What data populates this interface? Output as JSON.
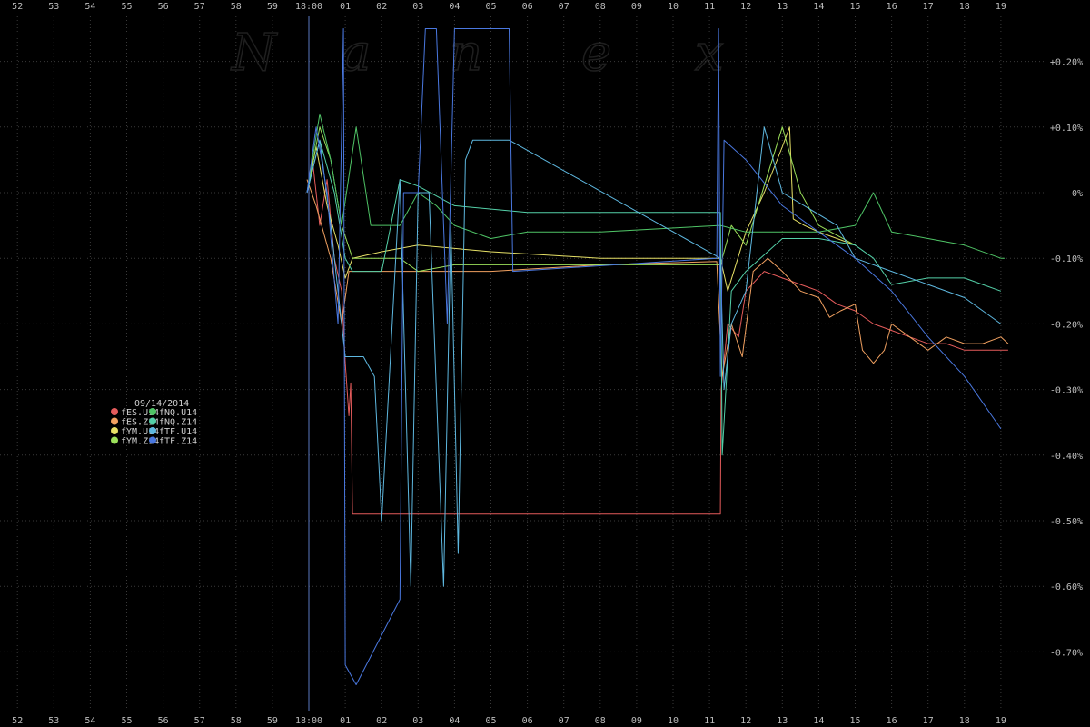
{
  "chart_data": {
    "type": "line",
    "title": "",
    "xlabel": "",
    "ylabel": "",
    "watermark": [
      "N",
      "a",
      "n",
      "e",
      "x"
    ],
    "date": "09/14/2014",
    "x_ticks_top": [
      "52",
      "53",
      "54",
      "55",
      "56",
      "57",
      "58",
      "59",
      "18:00",
      "01",
      "02",
      "03",
      "04",
      "05",
      "06",
      "07",
      "08",
      "09",
      "10",
      "11",
      "12",
      "13",
      "14",
      "15",
      "16",
      "17",
      "18",
      "19"
    ],
    "x_ticks_bottom": [
      "52",
      "53",
      "54",
      "55",
      "56",
      "57",
      "58",
      "59",
      "18:00",
      "01",
      "02",
      "03",
      "04",
      "05",
      "06",
      "07",
      "08",
      "09",
      "10",
      "11",
      "12",
      "13",
      "14",
      "15",
      "16",
      "17",
      "18",
      "19"
    ],
    "y_tick_labels": [
      "+0.20%",
      "+0.10%",
      "0%",
      "-0.10%",
      "-0.20%",
      "-0.30%",
      "-0.40%",
      "-0.50%",
      "-0.60%",
      "-0.70%"
    ],
    "y_ticks": [
      0.2,
      0.1,
      0,
      -0.1,
      -0.2,
      -0.3,
      -0.4,
      -0.5,
      -0.6,
      -0.7
    ],
    "ylim": [
      -0.82,
      0.26
    ],
    "xlim": [
      -8.4,
      19.4
    ],
    "grid": true,
    "legend_position": "left-middle",
    "colors": {
      "background": "#000000",
      "grid": "#3a3a3a",
      "tick_text": "#bdbdbd",
      "watermark": "#1f1f1f",
      "start_line": "#5a78c0"
    },
    "series": [
      {
        "name": "fES.U14",
        "color": "#e45b5b",
        "points": [
          [
            -0.05,
            0.0
          ],
          [
            0.1,
            0.05
          ],
          [
            0.3,
            -0.05
          ],
          [
            0.5,
            0.02
          ],
          [
            0.7,
            -0.1
          ],
          [
            0.9,
            -0.15
          ],
          [
            1.0,
            -0.26
          ],
          [
            1.05,
            -0.3
          ],
          [
            1.1,
            -0.34
          ],
          [
            1.15,
            -0.29
          ],
          [
            1.2,
            -0.49
          ],
          [
            11.3,
            -0.49
          ],
          [
            11.32,
            -0.3
          ],
          [
            11.5,
            -0.2
          ],
          [
            11.8,
            -0.22
          ],
          [
            12.0,
            -0.15
          ],
          [
            12.5,
            -0.12
          ],
          [
            13.0,
            -0.13
          ],
          [
            13.5,
            -0.14
          ],
          [
            14.0,
            -0.15
          ],
          [
            14.5,
            -0.17
          ],
          [
            15.0,
            -0.18
          ],
          [
            15.5,
            -0.2
          ],
          [
            16.0,
            -0.21
          ],
          [
            16.5,
            -0.22
          ],
          [
            17.0,
            -0.23
          ],
          [
            17.5,
            -0.23
          ],
          [
            18.0,
            -0.24
          ],
          [
            18.5,
            -0.24
          ],
          [
            19.0,
            -0.24
          ],
          [
            19.2,
            -0.24
          ]
        ]
      },
      {
        "name": "fES.Z14",
        "color": "#f0a060",
        "points": [
          [
            -0.05,
            0.02
          ],
          [
            0.2,
            -0.02
          ],
          [
            0.6,
            -0.1
          ],
          [
            0.9,
            -0.2
          ],
          [
            1.1,
            -0.12
          ],
          [
            1.5,
            -0.12
          ],
          [
            2.0,
            -0.12
          ],
          [
            3.0,
            -0.12
          ],
          [
            5.0,
            -0.12
          ],
          [
            8.0,
            -0.11
          ],
          [
            11.2,
            -0.105
          ],
          [
            11.35,
            -0.28
          ],
          [
            11.6,
            -0.2
          ],
          [
            11.9,
            -0.25
          ],
          [
            12.2,
            -0.12
          ],
          [
            12.6,
            -0.1
          ],
          [
            13.0,
            -0.12
          ],
          [
            13.5,
            -0.15
          ],
          [
            14.0,
            -0.16
          ],
          [
            14.3,
            -0.19
          ],
          [
            14.6,
            -0.18
          ],
          [
            15.0,
            -0.17
          ],
          [
            15.2,
            -0.24
          ],
          [
            15.5,
            -0.26
          ],
          [
            15.8,
            -0.24
          ],
          [
            16.0,
            -0.2
          ],
          [
            16.5,
            -0.22
          ],
          [
            17.0,
            -0.24
          ],
          [
            17.5,
            -0.22
          ],
          [
            18.0,
            -0.23
          ],
          [
            18.5,
            -0.23
          ],
          [
            19.0,
            -0.22
          ],
          [
            19.2,
            -0.23
          ]
        ]
      },
      {
        "name": "fYM.U14",
        "color": "#e6e066",
        "points": [
          [
            -0.05,
            0.0
          ],
          [
            0.2,
            0.07
          ],
          [
            0.5,
            -0.02
          ],
          [
            0.8,
            -0.08
          ],
          [
            1.0,
            -0.13
          ],
          [
            1.2,
            -0.1
          ],
          [
            2.0,
            -0.09
          ],
          [
            3.0,
            -0.08
          ],
          [
            5.0,
            -0.09
          ],
          [
            8.0,
            -0.1
          ],
          [
            11.3,
            -0.1
          ],
          [
            11.5,
            -0.15
          ],
          [
            12.0,
            -0.06
          ],
          [
            12.5,
            0.0
          ],
          [
            13.0,
            0.07
          ],
          [
            13.2,
            0.1
          ],
          [
            13.3,
            -0.04
          ],
          [
            13.6,
            -0.05
          ],
          [
            14.0,
            -0.06
          ],
          [
            14.5,
            -0.07
          ],
          [
            15.0,
            -0.08
          ]
        ]
      },
      {
        "name": "fYM.Z14",
        "color": "#9be05a",
        "points": [
          [
            -0.05,
            0.0
          ],
          [
            0.3,
            0.1
          ],
          [
            0.6,
            0.05
          ],
          [
            0.9,
            -0.05
          ],
          [
            1.2,
            -0.1
          ],
          [
            1.5,
            -0.1
          ],
          [
            2.5,
            -0.1
          ],
          [
            3.0,
            -0.12
          ],
          [
            4.0,
            -0.11
          ],
          [
            11.3,
            -0.11
          ],
          [
            11.6,
            -0.05
          ],
          [
            12.0,
            -0.08
          ],
          [
            13.0,
            0.1
          ],
          [
            13.5,
            0.0
          ],
          [
            14.0,
            -0.05
          ],
          [
            15.0,
            -0.08
          ]
        ]
      },
      {
        "name": "fNQ.U14",
        "color": "#4fc466",
        "points": [
          [
            -0.05,
            0.0
          ],
          [
            0.3,
            0.12
          ],
          [
            0.6,
            0.05
          ],
          [
            0.9,
            -0.05
          ],
          [
            1.3,
            0.1
          ],
          [
            1.7,
            -0.05
          ],
          [
            2.5,
            -0.05
          ],
          [
            3.0,
            0.0
          ],
          [
            3.5,
            -0.02
          ],
          [
            4.0,
            -0.05
          ],
          [
            5.0,
            -0.07
          ],
          [
            6.0,
            -0.06
          ],
          [
            8.0,
            -0.06
          ],
          [
            11.3,
            -0.05
          ],
          [
            12.0,
            -0.06
          ],
          [
            14.0,
            -0.06
          ],
          [
            15.0,
            -0.05
          ],
          [
            15.5,
            0.0
          ],
          [
            16.0,
            -0.06
          ],
          [
            17.0,
            -0.07
          ],
          [
            18.0,
            -0.08
          ],
          [
            19.0,
            -0.1
          ],
          [
            19.1,
            -0.1
          ]
        ]
      },
      {
        "name": "fNQ.Z14",
        "color": "#54d0a8",
        "points": [
          [
            -0.05,
            0.0
          ],
          [
            0.3,
            0.08
          ],
          [
            0.7,
            0.0
          ],
          [
            1.0,
            -0.1
          ],
          [
            1.2,
            -0.12
          ],
          [
            2.0,
            -0.12
          ],
          [
            2.5,
            0.02
          ],
          [
            3.0,
            0.01
          ],
          [
            4.0,
            -0.02
          ],
          [
            6.0,
            -0.03
          ],
          [
            9.0,
            -0.03
          ],
          [
            11.3,
            -0.03
          ],
          [
            11.35,
            -0.4
          ],
          [
            11.6,
            -0.15
          ],
          [
            12.0,
            -0.12
          ],
          [
            13.0,
            -0.07
          ],
          [
            14.0,
            -0.07
          ],
          [
            15.0,
            -0.08
          ],
          [
            15.5,
            -0.1
          ],
          [
            16.0,
            -0.14
          ],
          [
            17.0,
            -0.13
          ],
          [
            18.0,
            -0.13
          ],
          [
            18.5,
            -0.14
          ],
          [
            19.0,
            -0.15
          ]
        ]
      },
      {
        "name": "fTF.U14",
        "color": "#5eb8e0",
        "points": [
          [
            -0.05,
            0.0
          ],
          [
            0.3,
            0.08
          ],
          [
            0.6,
            -0.05
          ],
          [
            0.9,
            -0.2
          ],
          [
            1.0,
            -0.25
          ],
          [
            1.5,
            -0.25
          ],
          [
            1.8,
            -0.28
          ],
          [
            2.0,
            -0.5
          ],
          [
            2.5,
            0.02
          ],
          [
            2.8,
            -0.6
          ],
          [
            3.0,
            0.0
          ],
          [
            3.3,
            0.0
          ],
          [
            3.7,
            -0.6
          ],
          [
            3.9,
            -0.05
          ],
          [
            4.1,
            -0.55
          ],
          [
            4.3,
            0.05
          ],
          [
            4.5,
            0.08
          ],
          [
            5.5,
            0.08
          ],
          [
            11.3,
            -0.1
          ],
          [
            11.4,
            -0.3
          ],
          [
            11.6,
            -0.2
          ],
          [
            12.0,
            -0.15
          ],
          [
            12.5,
            0.1
          ],
          [
            13.0,
            0.0
          ],
          [
            14.5,
            -0.05
          ],
          [
            15.0,
            -0.1
          ],
          [
            16.0,
            -0.12
          ],
          [
            17.0,
            -0.14
          ],
          [
            18.0,
            -0.16
          ],
          [
            19.0,
            -0.2
          ]
        ]
      },
      {
        "name": "fTF.Z14",
        "color": "#4a78e0",
        "points": [
          [
            -0.05,
            0.0
          ],
          [
            0.2,
            0.1
          ],
          [
            0.5,
            0.0
          ],
          [
            0.8,
            -0.2
          ],
          [
            0.95,
            0.25
          ],
          [
            1.0,
            -0.72
          ],
          [
            1.3,
            -0.75
          ],
          [
            2.5,
            -0.62
          ],
          [
            2.6,
            0.0
          ],
          [
            3.0,
            0.0
          ],
          [
            3.2,
            0.25
          ],
          [
            3.5,
            0.25
          ],
          [
            3.8,
            -0.2
          ],
          [
            4.0,
            0.25
          ],
          [
            5.5,
            0.25
          ],
          [
            5.6,
            -0.12
          ],
          [
            11.2,
            -0.1
          ],
          [
            11.25,
            0.25
          ],
          [
            11.3,
            -0.28
          ],
          [
            11.4,
            0.08
          ],
          [
            12.0,
            0.05
          ],
          [
            13.0,
            -0.02
          ],
          [
            14.0,
            -0.06
          ],
          [
            14.5,
            -0.08
          ],
          [
            15.0,
            -0.1
          ],
          [
            16.0,
            -0.15
          ],
          [
            17.0,
            -0.22
          ],
          [
            18.0,
            -0.28
          ],
          [
            19.0,
            -0.36
          ]
        ]
      }
    ]
  }
}
